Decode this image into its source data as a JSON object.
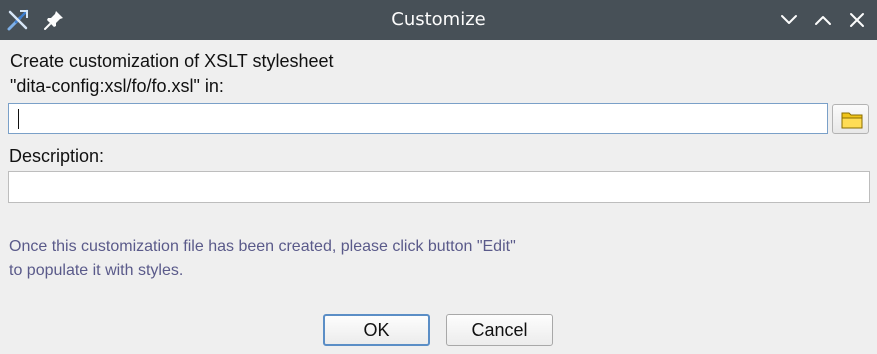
{
  "window": {
    "title": "Customize",
    "icons": {
      "app": "crossed-tools-icon",
      "pin": "pin-icon",
      "minimize": "chevron-down-icon",
      "maximize": "chevron-up-icon",
      "close": "close-icon"
    }
  },
  "form": {
    "heading_line1": "Create customization of XSLT stylesheet",
    "heading_line2": "\"dita-config:xsl/fo/fo.xsl\" in:",
    "path_value": "",
    "browse_icon": "folder-icon",
    "description_label": "Description:",
    "description_value": ""
  },
  "info": {
    "line1": "Once this customization file has been created, please click button \"Edit\"",
    "line2": "to populate it with styles."
  },
  "buttons": {
    "ok": "OK",
    "cancel": "Cancel"
  },
  "colors": {
    "titlebar": "#475057",
    "window_bg": "#efefef",
    "info_text": "#5a5a8a",
    "focus_border": "#5b8ec6"
  }
}
